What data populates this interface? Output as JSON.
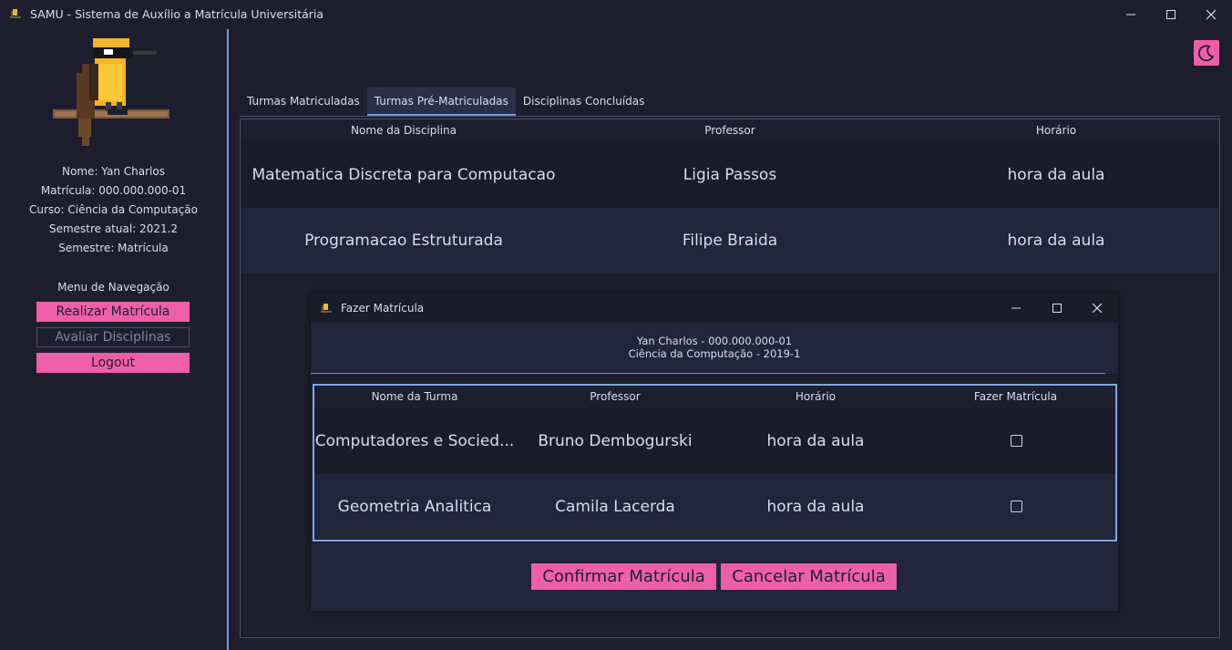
{
  "window": {
    "title": "SAMU - Sistema de Auxílio a Matrícula Universitária"
  },
  "sidebar": {
    "nome": "Nome: Yan Charlos",
    "matricula": "Matrícula: 000.000.000-01",
    "curso": "Curso: Ciência da Computação",
    "semestre_atual": "Semestre atual: 2021.2",
    "semestre": "Semestre: Matrícula",
    "menu_title": "Menu de Navegação",
    "buttons": {
      "realizar": "Realizar Matrícula",
      "avaliar": "Avaliar Disciplinas",
      "logout": "Logout"
    }
  },
  "tabs": [
    {
      "label": "Turmas Matriculadas"
    },
    {
      "label": "Turmas Pré-Matriculadas"
    },
    {
      "label": "Disciplinas Concluídas"
    }
  ],
  "main_table": {
    "headers": [
      "Nome da Disciplina",
      "Professor",
      "Horário"
    ],
    "rows": [
      [
        "Matematica Discreta para Computacao",
        "Ligia Passos",
        "hora da aula"
      ],
      [
        "Programacao Estruturada",
        "Filipe Braida",
        "hora da aula"
      ]
    ]
  },
  "dialog": {
    "title": "Fazer Matrícula",
    "student_line": "Yan Charlos - 000.000.000-01",
    "course_line": "Ciência da Computação - 2019-1",
    "headers": [
      "Nome da Turma",
      "Professor",
      "Horário",
      "Fazer Matrícula"
    ],
    "rows": [
      {
        "turma": "Computadores e Socied...",
        "professor": "Bruno Dembogurski",
        "horario": "hora da aula",
        "checked": false
      },
      {
        "turma": "Geometria Analitica",
        "professor": "Camila Lacerda",
        "horario": "hora da aula",
        "checked": false
      }
    ],
    "confirm_label": "Confirmar Matrícula",
    "cancel_label": "Cancelar Matrícula"
  },
  "colors": {
    "accent_pink": "#ef5fa7",
    "accent_blue": "#6f9ad8",
    "background": "#1e1f2e",
    "row_alt": "#23253a"
  },
  "icons": [
    "app-bird-icon",
    "minimize-icon",
    "maximize-icon",
    "close-icon",
    "moon-icon",
    "checkbox-icon"
  ]
}
